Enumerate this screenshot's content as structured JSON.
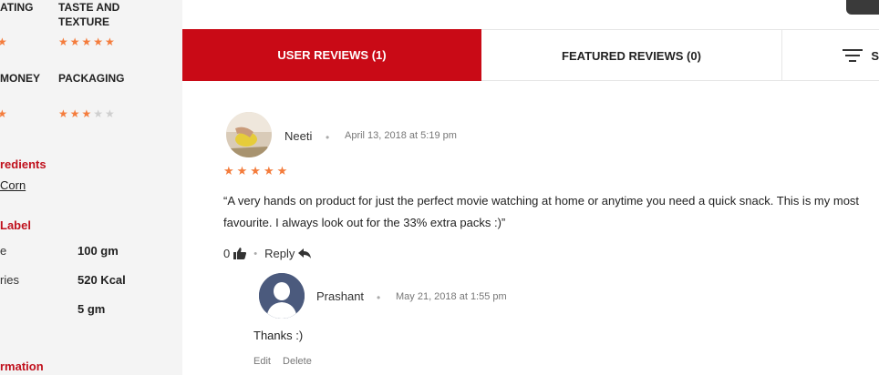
{
  "sidebar": {
    "rating_left_1": "ATING",
    "rating_right_1": "TASTE AND TEXTURE",
    "rating_left_2": "MONEY",
    "rating_right_2": "PACKAGING",
    "stars_left_1": "★",
    "stars_right_1": "★★★★★",
    "stars_left_2": "★",
    "stars_right_2_on": "★★★",
    "stars_right_2_off": "★★",
    "ingredients_title": "redients",
    "ingredient_item": "Corn",
    "label_title": "Label",
    "nutrition": [
      {
        "label": "e",
        "value": "100 gm"
      },
      {
        "label": "ries",
        "value": "520 Kcal"
      },
      {
        "label": "",
        "value": "5 gm"
      }
    ],
    "information_title": "rmation"
  },
  "tabs": {
    "user_reviews": "USER REVIEWS (1)",
    "featured_reviews": "FEATURED REVIEWS (0)",
    "sort_label": "S"
  },
  "review": {
    "author": "Neeti",
    "separator": "•",
    "date": "April 13, 2018 at 5:19 pm",
    "stars": "★★★★★",
    "text": "“A very hands on product for just the perfect movie watching at home or anytime you need a quick snack. This is my most favourite. I always look out for the 33% extra packs :)”",
    "likes": "0",
    "reply_label": "Reply"
  },
  "reply": {
    "author": "Prashant",
    "separator": "•",
    "date": "May 21, 2018 at 1:55 pm",
    "text": "Thanks :)",
    "edit_label": "Edit",
    "delete_label": "Delete"
  },
  "colors": {
    "accent": "#c90a16",
    "star": "#f47c3c",
    "section_title": "#c0111d",
    "avatar_bg": "#4b5a7d"
  },
  "icons": {
    "thumbs_up": "thumbs-up-icon",
    "reply": "reply-arrow-icon",
    "filter": "filter-lines-icon",
    "avatar_placeholder": "user-silhouette-icon"
  }
}
